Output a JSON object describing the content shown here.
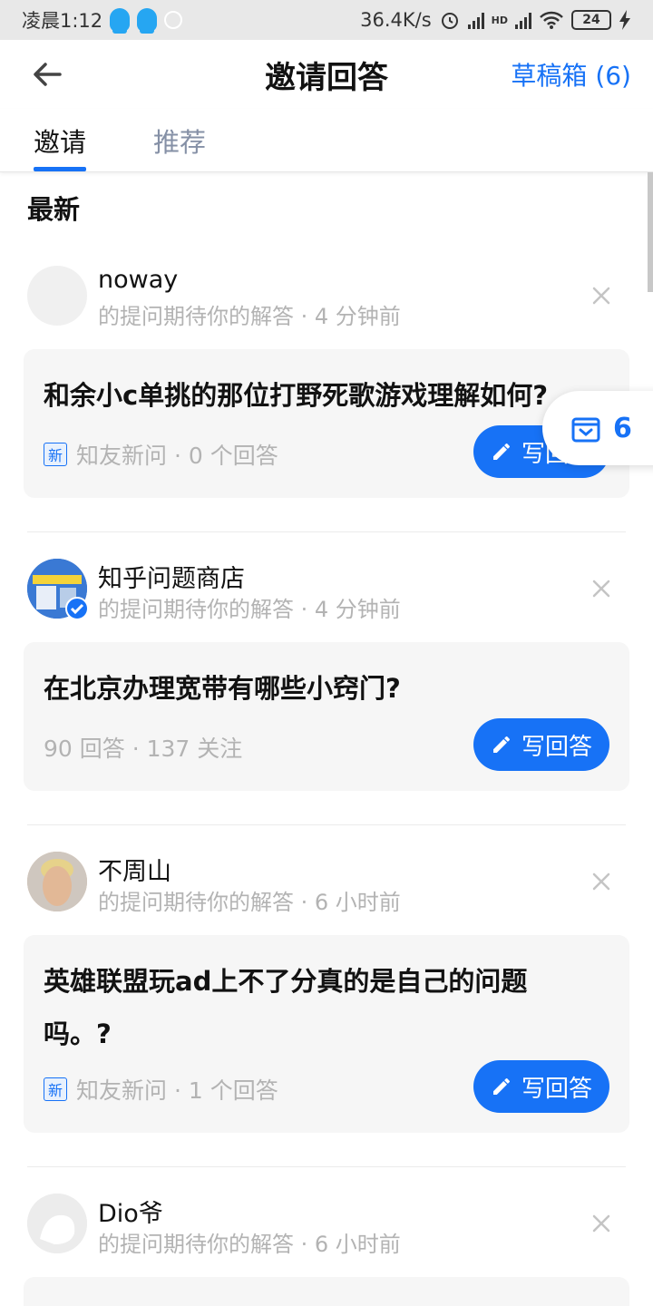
{
  "status_bar": {
    "time": "凌晨1:12",
    "network_speed": "36.4K/s",
    "network_type": "HD",
    "battery": "24"
  },
  "header": {
    "title": "邀请回答",
    "drafts_label": "草稿箱 (6)"
  },
  "tabs": [
    {
      "label": "邀请",
      "active": true
    },
    {
      "label": "推荐",
      "active": false
    }
  ],
  "section_title": "最新",
  "float_drafts_count": "6",
  "items": [
    {
      "user": "noway",
      "meta": "的提问期待你的解答 · 4 分钟前",
      "question": "和余小c单挑的那位打野死歌游戏理解如何?",
      "badge": "新",
      "stats": "知友新问 · 0 个回答",
      "answer_label": "写回答"
    },
    {
      "user": "知乎问题商店",
      "meta": "的提问期待你的解答 · 4 分钟前",
      "question": "在北京办理宽带有哪些小窍门?",
      "stats": "90 回答 · 137 关注",
      "answer_label": "写回答"
    },
    {
      "user": "不周山",
      "meta": "的提问期待你的解答 · 6 小时前",
      "question_line1": "英雄联盟玩ad上不了分真的是自己的问题",
      "question_line2": "吗。?",
      "badge": "新",
      "stats": "知友新问 · 1 个回答",
      "answer_label": "写回答"
    },
    {
      "user": "Dio爷",
      "meta": "的提问期待你的解答 · 6 小时前"
    }
  ],
  "colors": {
    "accent": "#1772f6",
    "muted": "#b3b3b3",
    "card_bg": "#f6f6f6"
  }
}
